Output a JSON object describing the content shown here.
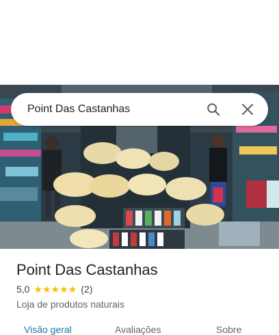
{
  "search": {
    "query": "Point Das Castanhas",
    "search_icon": "search-icon",
    "close_icon": "close-icon"
  },
  "photo": {
    "subject": "store-photo"
  },
  "place": {
    "name": "Point Das Castanhas",
    "rating": "5,0",
    "stars": 5,
    "review_count": "(2)",
    "category": "Loja de produtos naturais"
  },
  "tabs": [
    {
      "label": "Visão geral",
      "active": true
    },
    {
      "label": "Avaliações",
      "active": false
    },
    {
      "label": "Sobre",
      "active": false
    }
  ],
  "colors": {
    "accent": "#1a73a8",
    "star": "#fbbc04",
    "text_primary": "#202124",
    "text_secondary": "#5f6368"
  }
}
